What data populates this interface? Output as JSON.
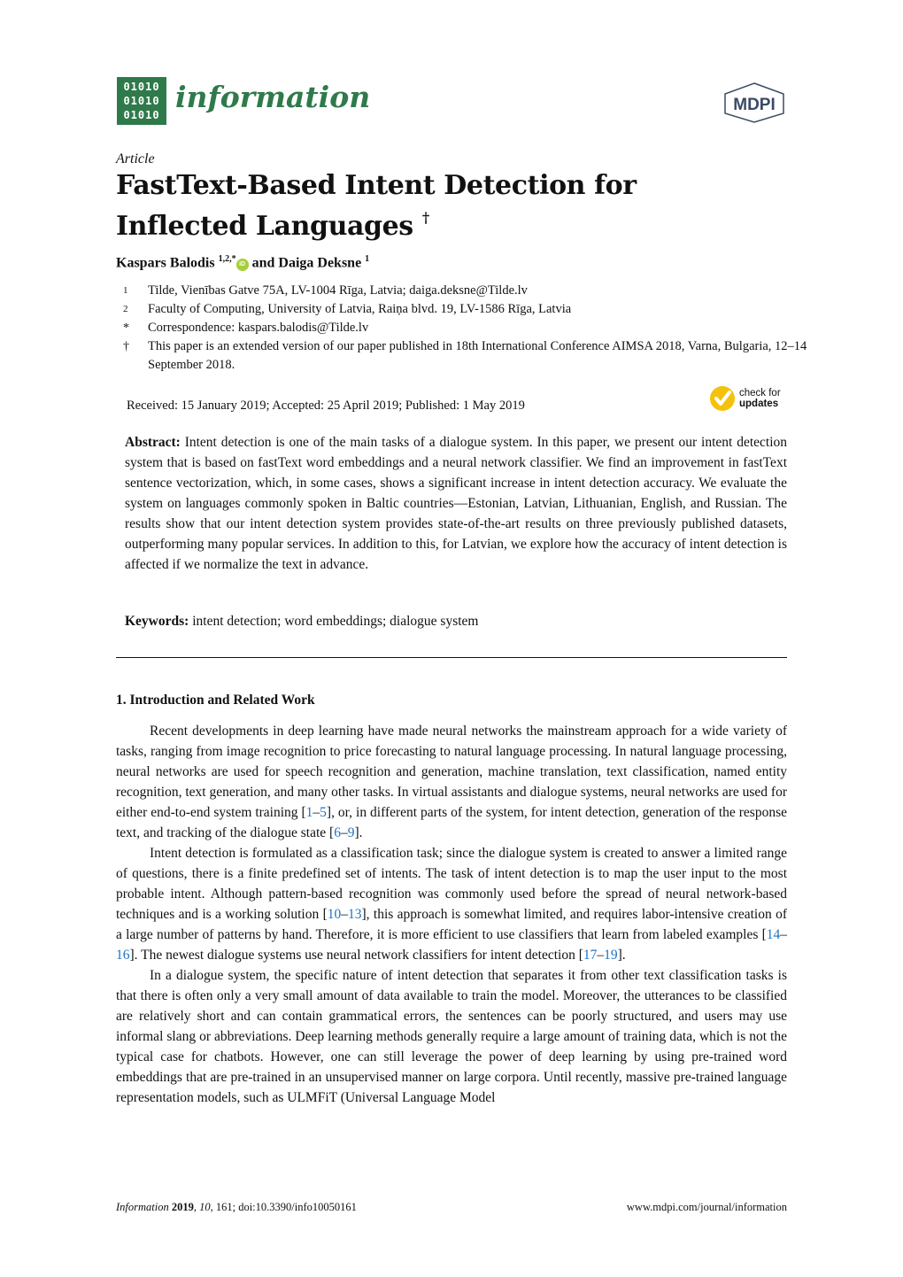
{
  "header": {
    "logo_rows": [
      "01010",
      "01010",
      "01010"
    ],
    "journal_name": "information",
    "publisher_logo": "MDPI",
    "brand_color": "#2f7a4a"
  },
  "article": {
    "type": "Article",
    "title_line1": "FastText-Based Intent Detection for",
    "title_line2": "Inflected Languages",
    "title_mark": "†",
    "authors": [
      {
        "name": "Kaspars Balodis",
        "sup": "1,2,*",
        "orcid": true
      },
      {
        "connector": "and"
      },
      {
        "name": "Daiga Deksne",
        "sup": "1"
      }
    ],
    "affiliations": [
      {
        "mark": "1",
        "text": "Tilde, Vienības Gatve 75A, LV-1004 Rīga, Latvia; daiga.deksne@Tilde.lv"
      },
      {
        "mark": "2",
        "text": "Faculty of Computing, University of Latvia, Raiņa blvd. 19, LV-1586 Rīga, Latvia"
      },
      {
        "mark": "*",
        "text": "Correspondence: kaspars.balodis@Tilde.lv"
      },
      {
        "mark": "†",
        "text": "This paper is an extended version of our paper published in 18th International Conference AIMSA 2018, Varna, Bulgaria, 12–14 September 2018."
      }
    ],
    "dates": "Received: 15 January 2019; Accepted: 25 April 2019; Published: 1 May 2019",
    "check_updates": {
      "line1": "check for",
      "line2": "updates"
    },
    "abstract_label": "Abstract:",
    "abstract_text": "Intent detection is one of the main tasks of a dialogue system. In this paper, we present our intent detection system that is based on fastText word embeddings and a neural network classifier. We find an improvement in fastText sentence vectorization, which, in some cases, shows a significant increase in intent detection accuracy. We evaluate the system on languages commonly spoken in Baltic countries—Estonian, Latvian, Lithuanian, English, and Russian. The results show that our intent detection system provides state-of-the-art results on three previously published datasets, outperforming many popular services. In addition to this, for Latvian, we explore how the accuracy of intent detection is affected if we normalize the text in advance.",
    "keywords_label": "Keywords:",
    "keywords_text": "intent detection; word embeddings; dialogue system"
  },
  "section": {
    "heading": "1. Introduction and Related Work",
    "p1": {
      "a": "Recent developments in deep learning have made neural networks the mainstream approach for a wide variety of tasks, ranging from image recognition to price forecasting to natural language processing. In natural language processing, neural networks are used for speech recognition and generation, machine translation, text classification, named entity recognition, text generation, and many other tasks. In virtual assistants and dialogue systems, neural networks are used for either end-to-end system training [",
      "c1a": "1",
      "d1": "–",
      "c1b": "5",
      "b": "], or, in different parts of the system, for intent detection, generation of the response text, and tracking of the dialogue state [",
      "c2a": "6",
      "d2": "–",
      "c2b": "9",
      "c": "]."
    },
    "p2": {
      "a": "Intent detection is formulated as a classification task; since the dialogue system is created to answer a limited range of questions, there is a finite predefined set of intents. The task of intent detection is to map the user input to the most probable intent. Although pattern-based recognition was commonly used before the spread of neural network-based techniques and is a working solution [",
      "c1a": "10",
      "d1": "–",
      "c1b": "13",
      "b": "], this approach is somewhat limited, and requires labor-intensive creation of a large number of patterns by hand. Therefore, it is more efficient to use classifiers that learn from labeled examples [",
      "c2a": "14",
      "d2": "–",
      "c2b": "16",
      "c": "]. The newest dialogue systems use neural network classifiers for intent detection [",
      "c3a": "17",
      "d3": "–",
      "c3b": "19",
      "d": "]."
    },
    "p3": "In a dialogue system, the specific nature of intent detection that separates it from other text classification tasks is that there is often only a very small amount of data available to train the model. Moreover, the utterances to be classified are relatively short and can contain grammatical errors, the sentences can be poorly structured, and users may use informal slang or abbreviations. Deep learning methods generally require a large amount of training data, which is not the typical case for chatbots. However, one can still leverage the power of deep learning by using pre-trained word embeddings that are pre-trained in an unsupervised manner on large corpora. Until recently, massive pre-trained language representation models, such as ULMFiT (Universal Language Model"
  },
  "footer": {
    "journal": "Information",
    "year": "2019",
    "volume": "10",
    "rest": ", 161; doi:10.3390/info10050161",
    "url": "www.mdpi.com/journal/information"
  },
  "colors": {
    "citation": "#1a73c4",
    "orcid": "#a6ce39",
    "check_updates": "#f4c20d"
  }
}
